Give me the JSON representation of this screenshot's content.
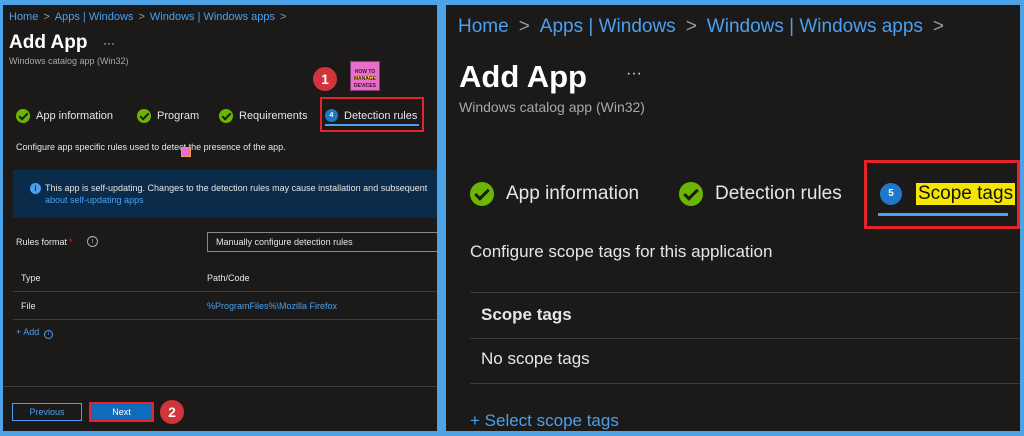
{
  "left": {
    "breadcrumb": [
      "Home",
      "Apps | Windows",
      "Windows | Windows apps"
    ],
    "breadcrumb_sep": ">",
    "title": "Add App",
    "more": "···",
    "subtitle": "Windows catalog app (Win32)",
    "tabs": [
      {
        "label": "App information",
        "state": "done"
      },
      {
        "label": "Program",
        "state": "done"
      },
      {
        "label": "Requirements",
        "state": "done"
      },
      {
        "label": "Detection rules",
        "state": "active",
        "step": "4"
      }
    ],
    "description": "Configure app specific rules used to detect the presence of the app.",
    "info": {
      "icon": "i",
      "text": "This app is self-updating. Changes to the detection rules may cause installation and subsequent",
      "link": "about self-updating apps"
    },
    "rules_format": {
      "label": "Rules format",
      "required": "*",
      "help": "i",
      "value": "Manually configure detection rules"
    },
    "table": {
      "headers": [
        "Type",
        "Path/Code"
      ],
      "rows": [
        {
          "type": "File",
          "path": "%ProgramFiles%\\Mozilla Firefox"
        }
      ]
    },
    "add_label": "+ Add",
    "add_help": "i",
    "buttons": {
      "previous": "Previous",
      "next": "Next"
    },
    "logo_text": [
      "HOW TO",
      "MANAGE",
      "DEVICES"
    ]
  },
  "annotations": {
    "badge1": "1",
    "badge2": "2"
  },
  "right": {
    "breadcrumb": [
      "Home",
      "Apps | Windows",
      "Windows | Windows apps"
    ],
    "breadcrumb_sep": ">",
    "title": "Add App",
    "more": "···",
    "subtitle": "Windows catalog app (Win32)",
    "tabs": [
      {
        "label": "App information",
        "state": "done"
      },
      {
        "label": "Detection rules",
        "state": "done"
      },
      {
        "label": "Scope tags",
        "state": "active",
        "step": "5"
      }
    ],
    "description": "Configure scope tags for this application",
    "table_header": "Scope tags",
    "empty_text": "No scope tags",
    "select_link": "+ Select scope tags"
  },
  "colors": {
    "background": "#1b1a19",
    "frame": "#4ea3e6",
    "link": "#4ba0ee",
    "check": "#6bb700",
    "highlight_red": "#e3242b",
    "primary_button": "#0f6cbd",
    "highlight_yellow": "#f5e600"
  }
}
